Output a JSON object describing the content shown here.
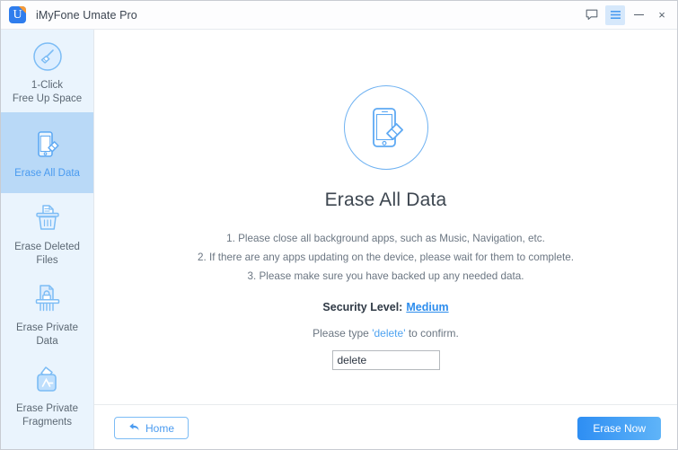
{
  "window": {
    "title": "iMyFone Umate Pro",
    "app_icon": "umate-logo-icon"
  },
  "titlebar": {
    "feedback_icon": "message-bubble-icon",
    "menu_icon": "hamburger-menu-icon",
    "minimize_icon": "minimize-icon",
    "close_icon": "close-icon",
    "close_glyph": "×"
  },
  "sidebar": {
    "items": [
      {
        "label_line1": "1-Click",
        "label_line2": "Free Up Space",
        "icon": "broom-circle-icon",
        "active": false
      },
      {
        "label_line1": "Erase All Data",
        "label_line2": "",
        "icon": "phone-erase-icon",
        "active": true
      },
      {
        "label_line1": "Erase Deleted Files",
        "label_line2": "",
        "icon": "trash-document-icon",
        "active": false
      },
      {
        "label_line1": "Erase Private Data",
        "label_line2": "",
        "icon": "shredder-lock-icon",
        "active": false
      },
      {
        "label_line1": "Erase Private",
        "label_line2": "Fragments",
        "icon": "app-fragments-icon",
        "active": false
      }
    ]
  },
  "main": {
    "hero_icon": "phone-erase-large-icon",
    "title": "Erase All Data",
    "steps": [
      "1. Please close all background apps, such as Music, Navigation, etc.",
      "2. If there are any apps updating on the device, please wait for them to complete.",
      "3. Please make sure you have backed up any needed data."
    ],
    "security_label": "Security Level:",
    "security_value": "Medium",
    "confirm_prefix": "Please type",
    "confirm_word": "'delete'",
    "confirm_suffix": "to confirm.",
    "input_value": "delete",
    "input_placeholder": ""
  },
  "footer": {
    "home_label": "Home",
    "home_icon": "back-arrow-icon",
    "erase_label": "Erase Now"
  },
  "colors": {
    "accent": "#4a9bf0",
    "sidebar_bg": "#eaf4fd",
    "sidebar_active_bg": "#b9d9f7",
    "link": "#2d8ded",
    "primary_button_from": "#2e8ef3",
    "primary_button_to": "#5fb4f8",
    "icon_stroke": "#7cbcf5",
    "text_muted": "#6b7682",
    "text_dark": "#3d4650"
  }
}
